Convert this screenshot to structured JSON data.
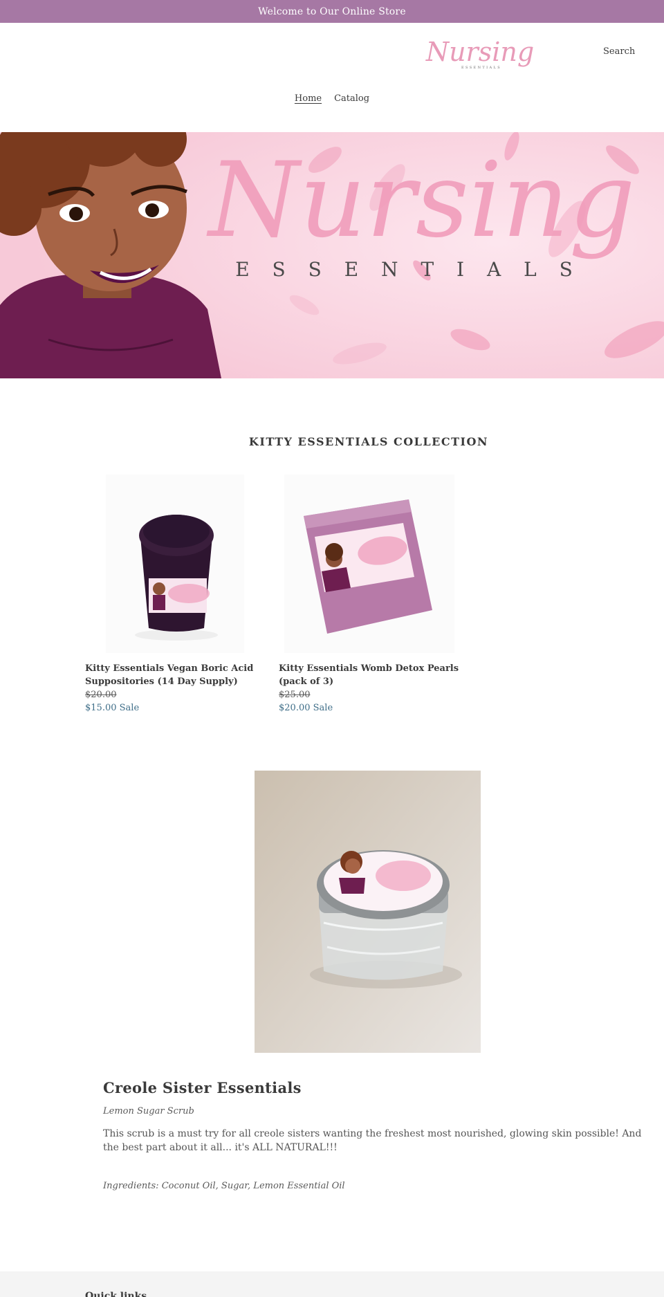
{
  "announcement": {
    "text": "Welcome to Our Online Store"
  },
  "header": {
    "logo": {
      "script_text": "Nursing",
      "sub_text": "ESSENTIALS"
    },
    "search_label": "Search",
    "nav": [
      {
        "label": "Home",
        "active": true
      },
      {
        "label": "Catalog",
        "active": false
      }
    ]
  },
  "hero": {
    "script_text": "Nursing",
    "sub_text": "E S S E N T I A L S"
  },
  "collection": {
    "title": "KITTY ESSENTIALS COLLECTION",
    "products": [
      {
        "name": "Kitty Essentials Vegan Boric Acid Suppositories (14 Day Supply)",
        "original_price": "$20.00",
        "sale_price": "$15.00",
        "sale_label": "Sale"
      },
      {
        "name": "Kitty Essentials Womb Detox Pearls (pack of 3)",
        "original_price": "$25.00",
        "sale_price": "$20.00",
        "sale_label": "Sale"
      }
    ]
  },
  "feature": {
    "title": "Creole Sister Essentials",
    "subtitle": "Lemon Sugar Scrub",
    "body": "This scrub is a must try for all creole sisters wanting the freshest most nourished, glowing skin possible! And the best part about it all... it's ALL NATURAL!!!",
    "ingredients": "Ingredients:  Coconut Oil, Sugar, Lemon Essential Oil"
  },
  "footer": {
    "heading": "Quick links"
  },
  "colors": {
    "announcement_bg": "#a678a4",
    "brand_pink": "#e89bb8",
    "sale_price": "#3f6e88",
    "product_purple": "#b77aa8"
  }
}
